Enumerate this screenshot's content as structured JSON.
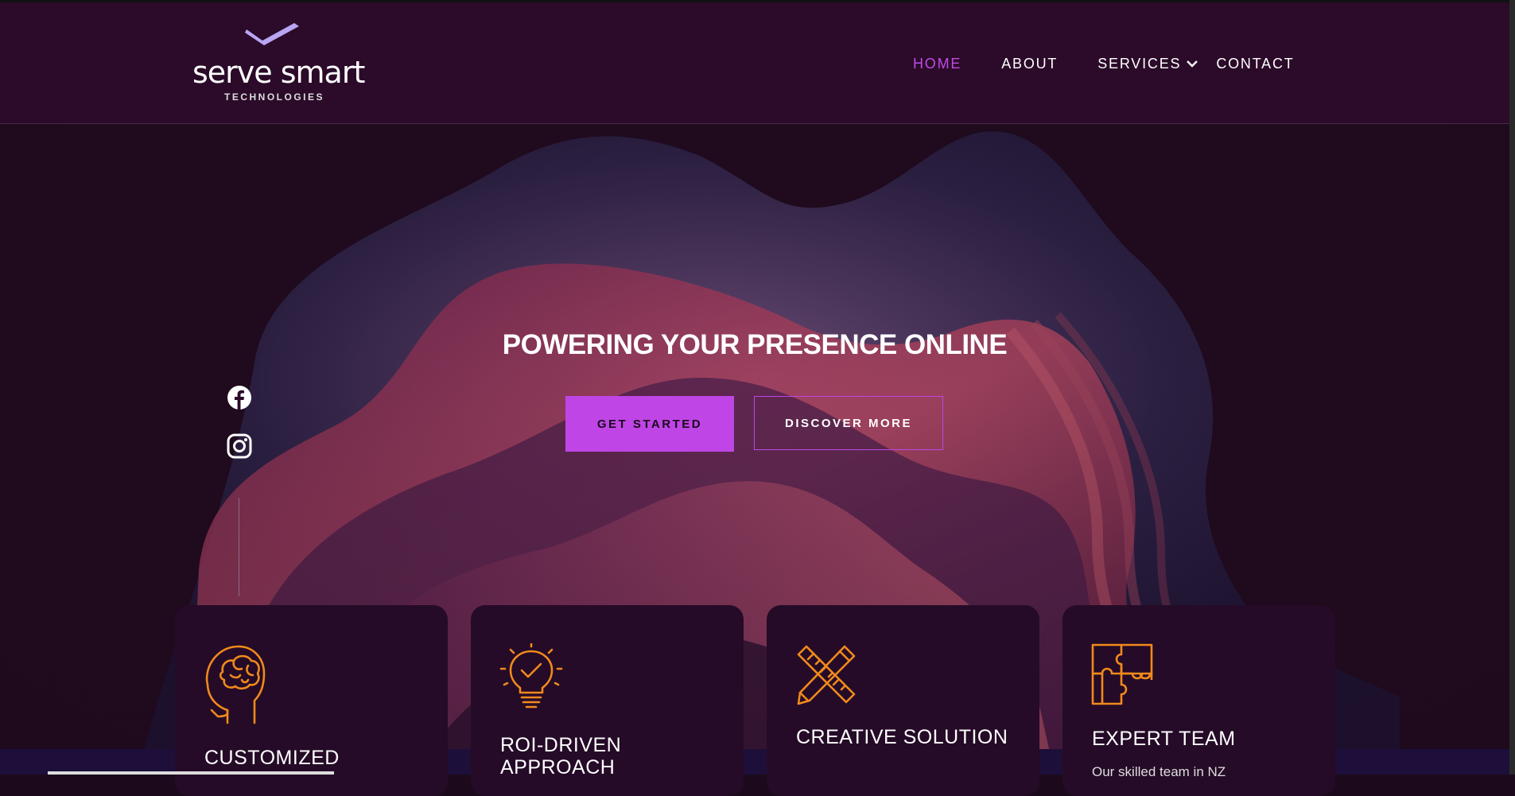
{
  "brand": {
    "name": "serve smart",
    "tagline": "TECHNOLOGIES"
  },
  "nav": [
    {
      "label": "HOME",
      "active": true
    },
    {
      "label": "ABOUT",
      "active": false
    },
    {
      "label": "SERVICES",
      "active": false,
      "has_dropdown": true
    },
    {
      "label": "CONTACT",
      "active": false
    }
  ],
  "hero": {
    "title": "POWERING YOUR PRESENCE ONLINE",
    "primary_button": "GET STARTED",
    "secondary_button": "DISCOVER MORE"
  },
  "social": [
    {
      "icon": "facebook-icon"
    },
    {
      "icon": "instagram-icon"
    }
  ],
  "cards": [
    {
      "icon": "brain-head-icon",
      "title": "CUSTOMIZED"
    },
    {
      "icon": "lightbulb-check-icon",
      "title": "ROI-DRIVEN APPROACH"
    },
    {
      "icon": "pencil-ruler-icon",
      "title": "CREATIVE SOLUTION"
    },
    {
      "icon": "puzzle-icon",
      "title": "EXPERT TEAM",
      "text": "Our skilled team in NZ"
    }
  ],
  "colors": {
    "accent": "#bf45e6",
    "icon_orange": "#f08a1c",
    "header_bg": "#2b0b29",
    "card_bg": "#250b27"
  }
}
